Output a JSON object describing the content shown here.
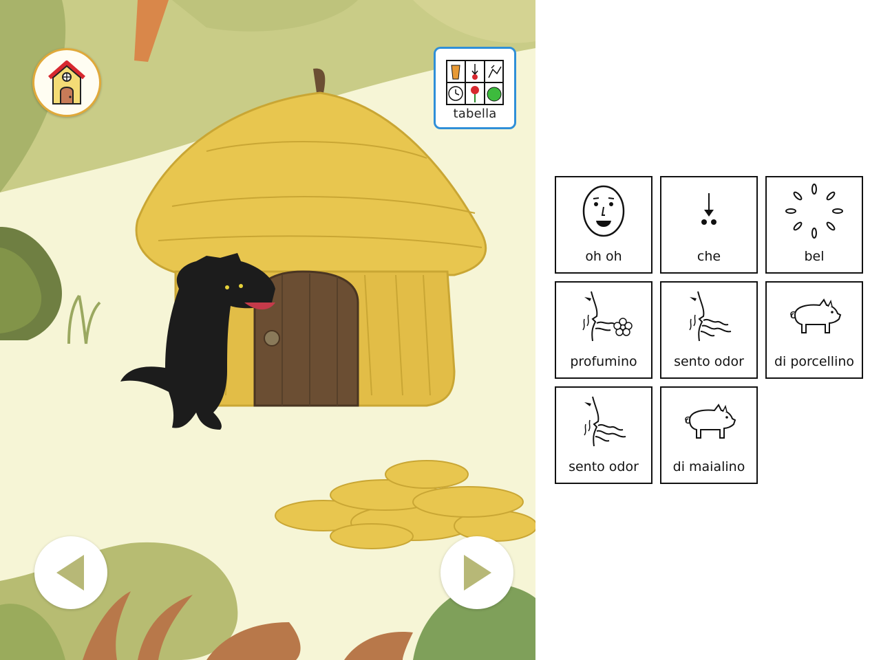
{
  "scene": {
    "tabella_label": "tabella",
    "colors": {
      "ground": "#f6f5d6",
      "foliage_light": "#cdcf8c",
      "foliage_mid": "#a9b36a",
      "foliage_dark": "#6f7f42",
      "straw": "#e8c64f",
      "door": "#6b4e33",
      "accent_blue": "#2f8fd8"
    }
  },
  "symbols": [
    {
      "label": "oh oh",
      "icon": "face-surprised-icon"
    },
    {
      "label": "che",
      "icon": "arrow-dots-icon"
    },
    {
      "label": "bel",
      "icon": "sparkle-icon"
    },
    {
      "label": "profumino",
      "icon": "smell-flower-icon"
    },
    {
      "label": "sento odor",
      "icon": "smell-icon"
    },
    {
      "label": "di porcellino",
      "icon": "piglet-icon"
    },
    {
      "label": "sento odor",
      "icon": "smell-icon"
    },
    {
      "label": "di maialino",
      "icon": "pig-icon"
    }
  ]
}
